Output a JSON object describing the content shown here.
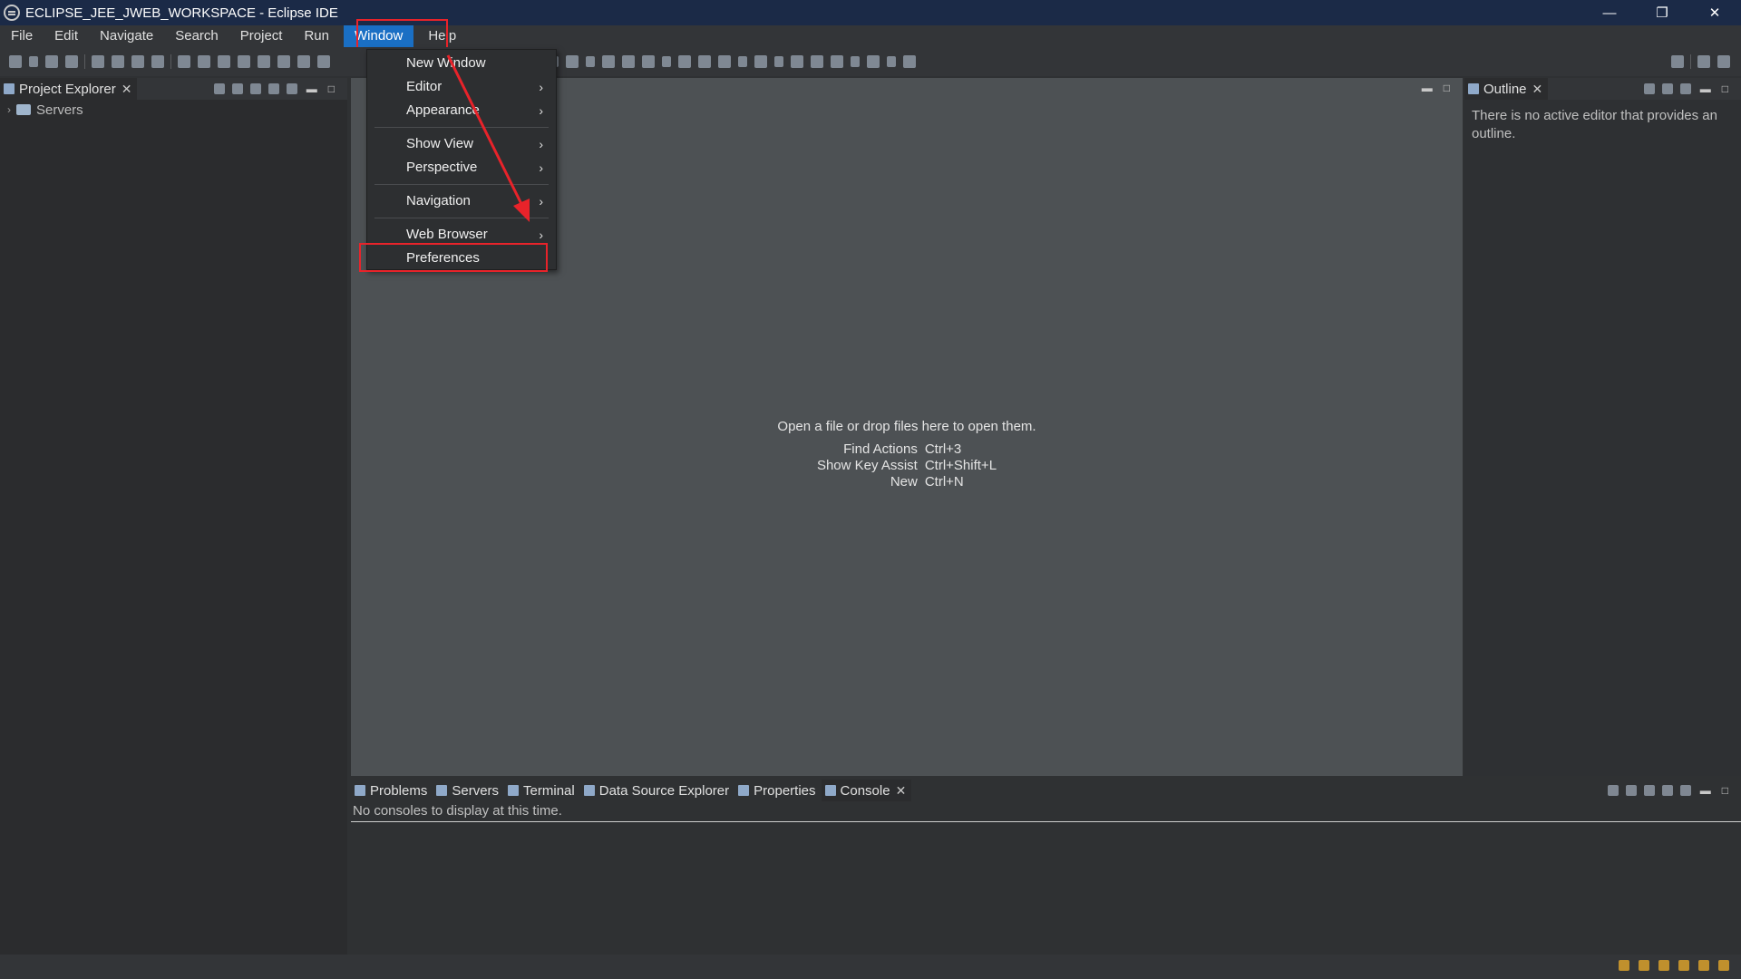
{
  "window": {
    "title": "ECLIPSE_JEE_JWEB_WORKSPACE - Eclipse IDE",
    "controls": [
      "—",
      "❐",
      "✕"
    ]
  },
  "menubar": [
    "File",
    "Edit",
    "Navigate",
    "Search",
    "Project",
    "Run",
    "Window",
    "Help"
  ],
  "window_menu": {
    "items": [
      {
        "label": "New Window",
        "submenu": false
      },
      {
        "label": "Editor",
        "submenu": true
      },
      {
        "label": "Appearance",
        "submenu": true
      },
      {
        "label": "Show View",
        "submenu": true
      },
      {
        "label": "Perspective",
        "submenu": true
      },
      {
        "label": "Navigation",
        "submenu": true
      },
      {
        "label": "Web Browser",
        "submenu": true
      },
      {
        "label": "Preferences",
        "submenu": false
      }
    ],
    "submenu_arrow": "›"
  },
  "project_explorer": {
    "tab_label": "Project Explorer",
    "tree": [
      {
        "label": "Servers",
        "chevron": "›"
      }
    ]
  },
  "editor": {
    "message": "Open a file or drop files here to open them.",
    "shortcuts": [
      {
        "action": "Find Actions",
        "keys": "Ctrl+3"
      },
      {
        "action": "Show Key Assist",
        "keys": "Ctrl+Shift+L"
      },
      {
        "action": "New",
        "keys": "Ctrl+N"
      }
    ]
  },
  "outline": {
    "tab_label": "Outline",
    "message": "There is no active editor that provides an outline."
  },
  "bottom_panel": {
    "tabs": [
      "Problems",
      "Servers",
      "Terminal",
      "Data Source Explorer",
      "Properties",
      "Console"
    ],
    "console_message": "No consoles to display at this time."
  },
  "ui": {
    "close_glyph": "✕",
    "minimize_glyph": "▬",
    "maximize_glyph": "□"
  },
  "colors": {
    "accent": "#1a6fc4",
    "annotation": "#e8232a",
    "editor_bg": "#4d5154",
    "titlebar_bg": "#1b2a47"
  }
}
